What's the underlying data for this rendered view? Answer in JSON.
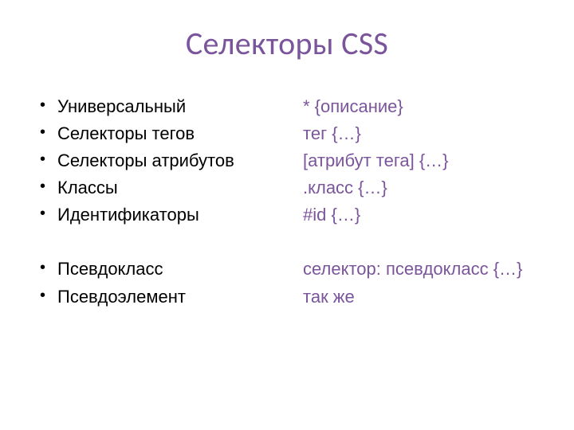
{
  "title": "Селекторы CSS",
  "left": {
    "group1": [
      "Универсальный",
      "Селекторы тегов",
      "Селекторы атрибутов",
      "Классы",
      "Идентификаторы"
    ],
    "group2": [
      "Псевдокласс",
      "Псевдоэлемент"
    ]
  },
  "right": {
    "group1": [
      "* {описание}",
      "тег {…}",
      "[атрибут тега] {…}",
      ".класс {…}",
      "#id {…}"
    ],
    "group2": [
      "селектор: псевдокласс {…}",
      "так же"
    ]
  }
}
